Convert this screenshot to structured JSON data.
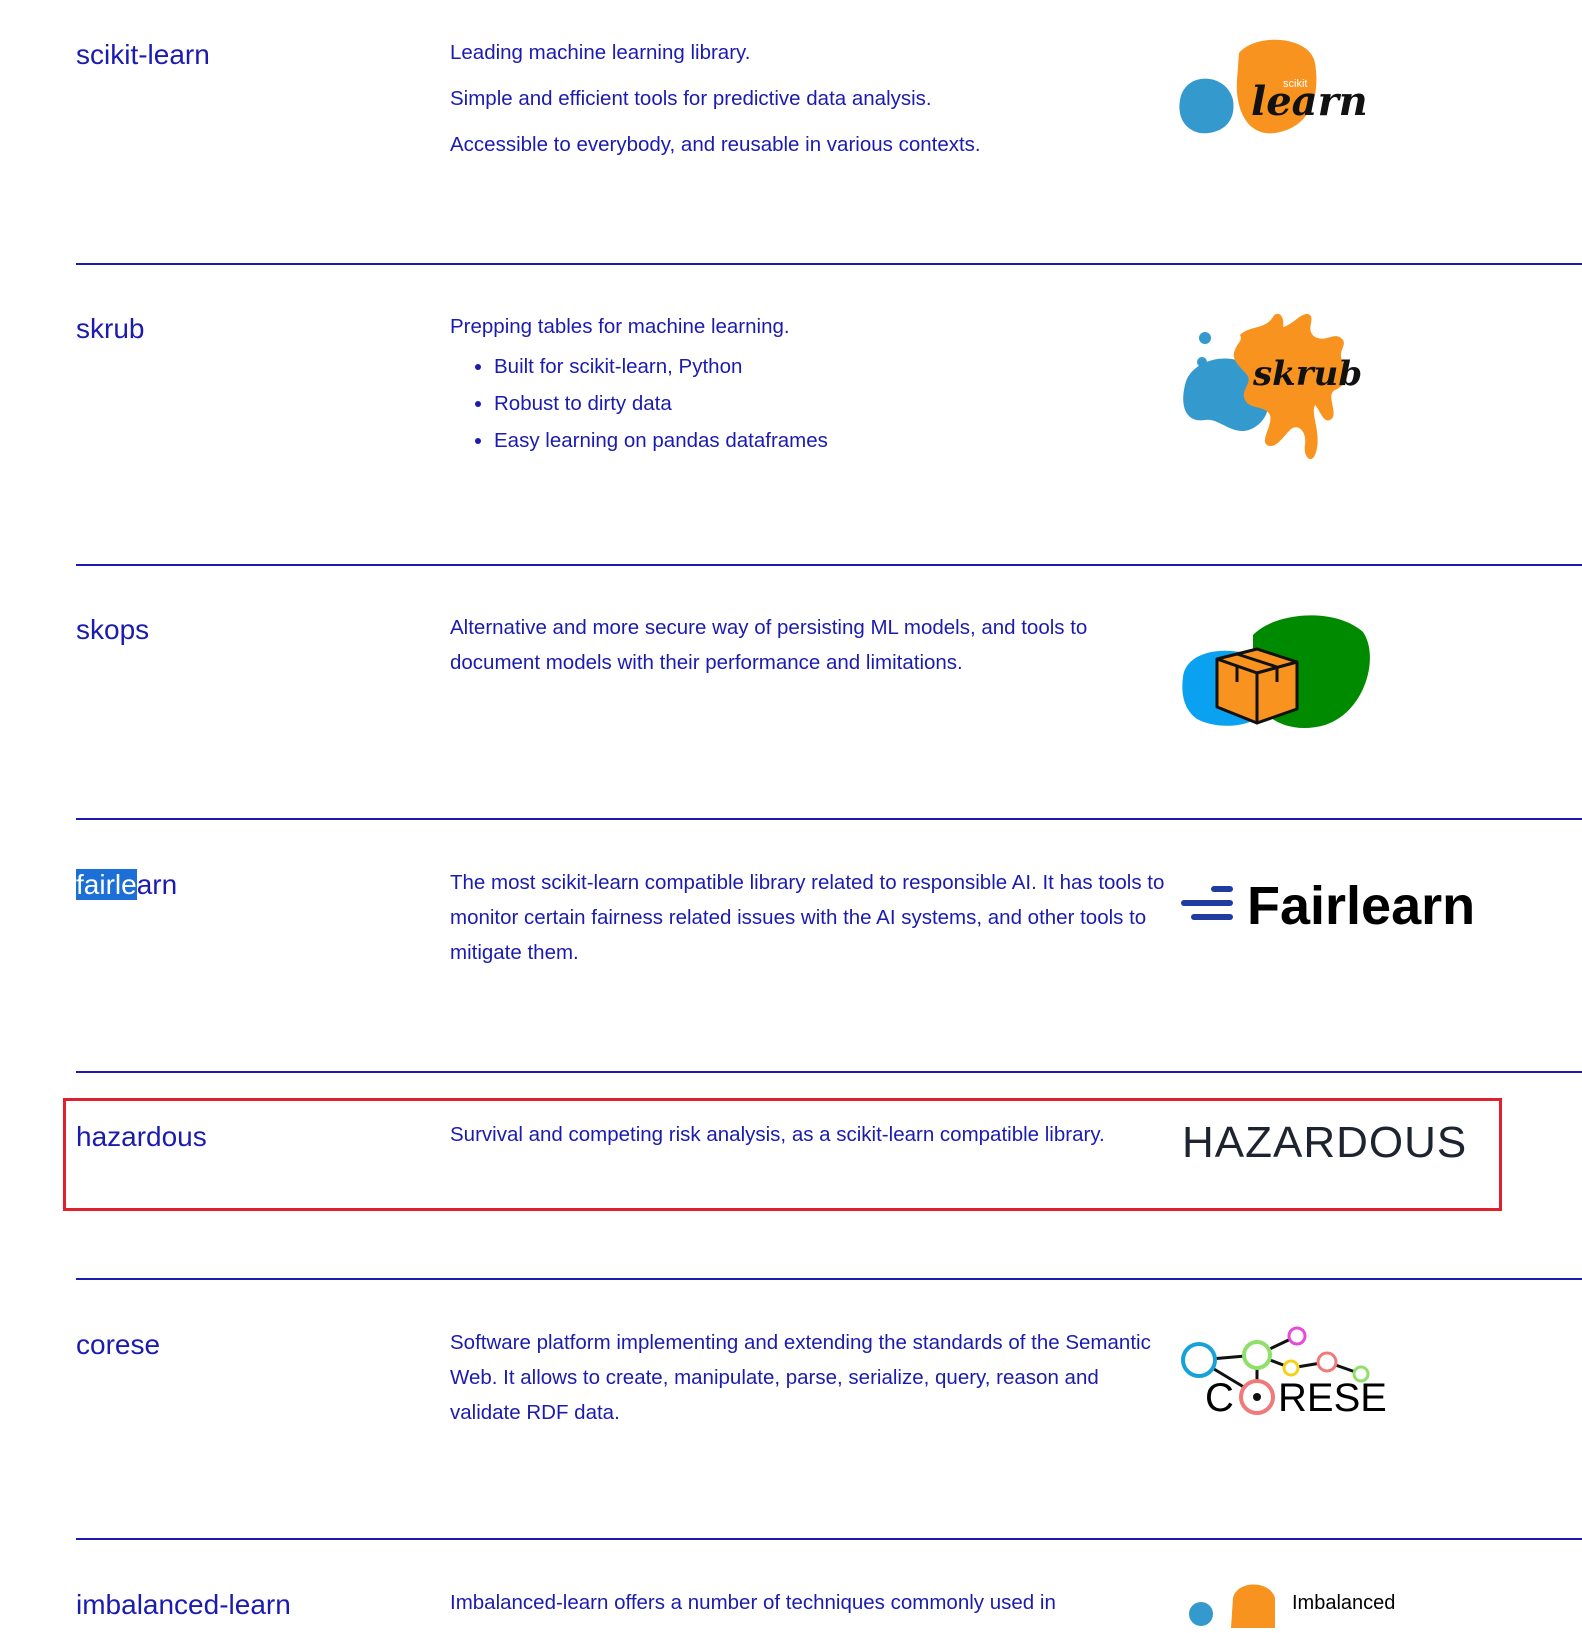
{
  "projects": [
    {
      "name": "scikit-learn",
      "desc": [
        "Leading machine learning library.",
        "Simple and efficient tools for predictive data analysis.",
        "Accessible to everybody, and reusable in various contexts."
      ],
      "logo_text": {
        "top": "scikit",
        "main": "learn"
      }
    },
    {
      "name": "skrub",
      "intro": "Prepping tables for machine learning.",
      "bullets": [
        "Built for scikit-learn, Python",
        "Robust to dirty data",
        "Easy learning on pandas dataframes"
      ],
      "logo_text": "skrub"
    },
    {
      "name": "skops",
      "desc": "Alternative and more secure way of persisting ML models, and tools to document models with their performance and limitations."
    },
    {
      "name_selected": "fairle",
      "name_rest": "arn",
      "desc": "The most scikit-learn compatible library related to responsible AI. It has tools to monitor certain fairness related issues with the AI systems, and other tools to mitigate them.",
      "logo_text": "Fairlearn"
    },
    {
      "name": "hazardous",
      "desc": "Survival and competing risk analysis, as a scikit-learn compatible library.",
      "logo_text": "HAZARDOUS"
    },
    {
      "name": "corese",
      "desc": "Software platform implementing and extending the standards of the Semantic Web. It allows to create, manipulate, parse, serialize, query, reason and validate RDF data.",
      "logo_text": {
        "left": "C",
        "right": "RESE"
      }
    },
    {
      "name": "imbalanced-learn",
      "desc": "Imbalanced-learn offers a number of techniques commonly used in",
      "logo_text": "Imbalanced"
    }
  ],
  "colors": {
    "text": "#1b1bb0",
    "highlight_border": "#e0202c",
    "selection": "#1c6fd6",
    "sklearn_orange": "#f7931e",
    "sklearn_blue": "#3499cd",
    "skops_green": "#008a00",
    "skops_blue": "#0aa1f0",
    "fairlearn_blue": "#1f3c9e"
  }
}
